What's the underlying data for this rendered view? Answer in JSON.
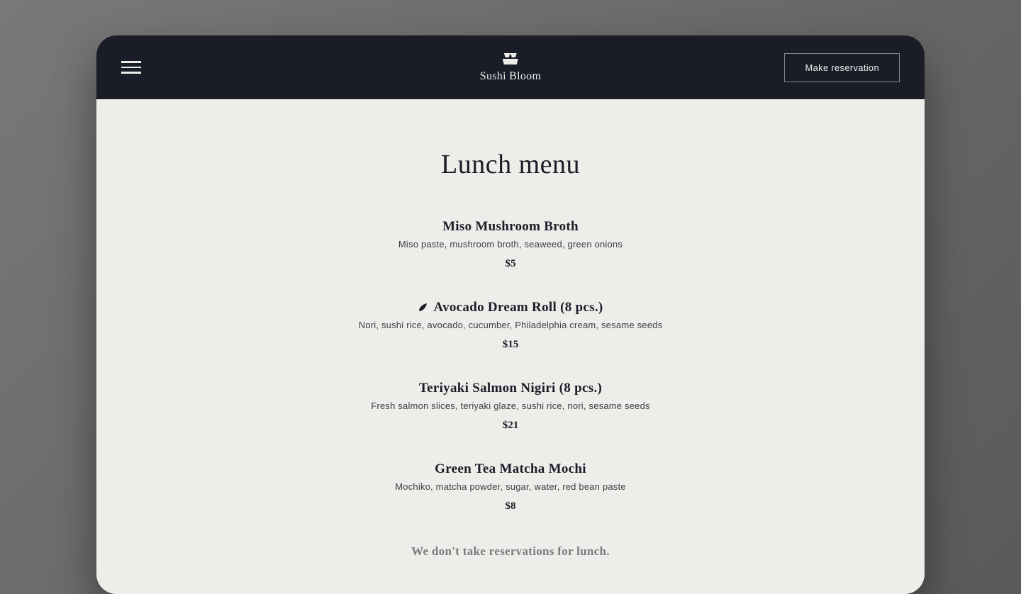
{
  "header": {
    "brand_name": "Sushi Bloom",
    "reserve_button": "Make reservation"
  },
  "page": {
    "title": "Lunch menu",
    "footer_note": "We don't take reservations for lunch."
  },
  "menu": [
    {
      "title": "Miso Mushroom Broth",
      "description": "Miso paste, mushroom broth, seaweed, green onions",
      "price": "$5",
      "has_icon": false
    },
    {
      "title": "Avocado Dream Roll (8 pcs.)",
      "description": "Nori, sushi rice, avocado, cucumber, Philadelphia cream, sesame seeds",
      "price": "$15",
      "has_icon": true
    },
    {
      "title": "Teriyaki Salmon Nigiri (8 pcs.)",
      "description": "Fresh salmon slices, teriyaki glaze, sushi rice, nori, sesame seeds",
      "price": "$21",
      "has_icon": false
    },
    {
      "title": "Green Tea Matcha Mochi",
      "description": "Mochiko, matcha powder, sugar, water, red bean paste",
      "price": "$8",
      "has_icon": false
    }
  ]
}
